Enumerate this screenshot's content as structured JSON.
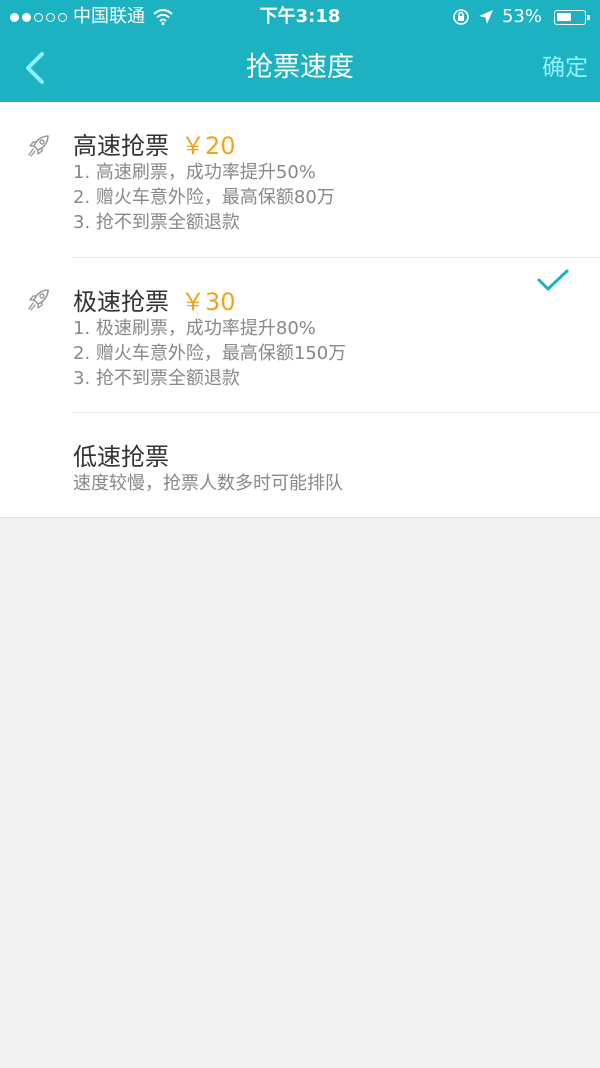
{
  "status_bar": {
    "carrier": "中国联通",
    "time": "下午3:18",
    "battery": "53%",
    "battery_level": 0.53
  },
  "nav": {
    "title": "抢票速度",
    "confirm_label": "确定",
    "back_icon": "chevron-left-icon"
  },
  "options": [
    {
      "name": "高速抢票",
      "price": "￥20",
      "lines": [
        "1. 高速刷票，成功率提升50%",
        "2. 赠火车意外险，最高保额80万",
        "3. 抢不到票全额退款"
      ],
      "icon": "rocket-icon",
      "selected": false
    },
    {
      "name": "极速抢票",
      "price": "￥30",
      "lines": [
        "1. 极速刷票，成功率提升80%",
        "2. 赠火车意外险，最高保额150万",
        "3. 抢不到票全额退款"
      ],
      "icon": "rocket-icon",
      "selected": true
    },
    {
      "name": "低速抢票",
      "price": "",
      "lines": [
        "速度较慢，抢票人数多时可能排队"
      ],
      "selected": false
    }
  ],
  "colors": {
    "header": "#1db2c2",
    "price": "#f0a41e",
    "check": "#1db2c2",
    "confirm": "#8ff0ff"
  }
}
